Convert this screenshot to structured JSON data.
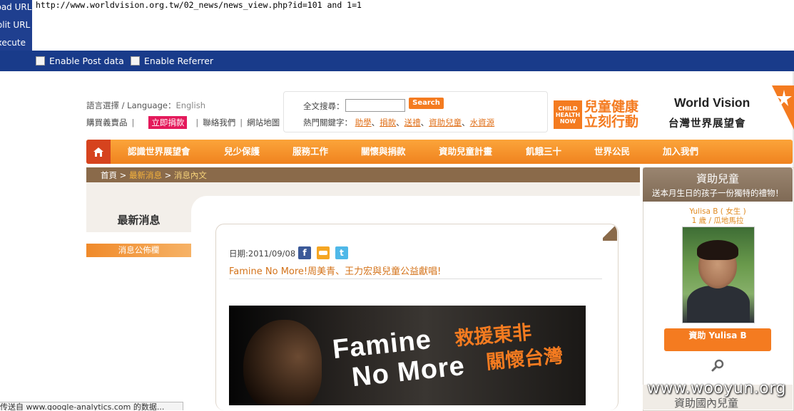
{
  "hackbar": {
    "left_items": [
      "Load URL",
      "Split URL",
      "Execute"
    ],
    "url": "http://www.worldvision.org.tw/02_news/news_view.php?id=101 and 1=1",
    "enable_post": "Enable Post data",
    "enable_referrer": "Enable Referrer"
  },
  "header": {
    "language_label": "語言選擇 / Language：",
    "language_value": "English",
    "links": {
      "shop": "購買義賣品",
      "donate": "立即捐款",
      "contact": "聯絡我們",
      "sitemap": "網站地圖"
    },
    "search": {
      "label": "全文搜尋：",
      "button": "Search >",
      "value": ""
    },
    "hot_label": "熱門關鍵字：",
    "hot_keywords": [
      "助學",
      "捐款",
      "送禮",
      "資助兒童",
      "水資源"
    ],
    "child_health": {
      "box": "CHILD HEALTH NOW",
      "line1": "兒童健康",
      "line2": "立刻行動"
    },
    "wv_logo": {
      "en": "World Vision",
      "zh": "台灣世界展望會"
    }
  },
  "nav": {
    "items": [
      "認識世界展望會",
      "兒少保護",
      "服務工作",
      "關懷與捐款",
      "資助兒童計畫",
      "飢餓三十",
      "世界公民",
      "加入我們"
    ]
  },
  "breadcrumb": {
    "home": "首頁",
    "sep": ">",
    "section": "最新消息",
    "current": "消息內文"
  },
  "sidebar": {
    "title": "最新消息",
    "item": "消息公佈欄"
  },
  "article": {
    "date": "日期:2011/09/08",
    "title": "Famine No More!周美青、王力宏與兒童公益獻唱!",
    "banner_en_1": "Famine",
    "banner_en_2": "No More",
    "banner_zh_1": "救援東非",
    "banner_zh_2": "關懷台灣"
  },
  "sponsor": {
    "title": "資助兒童",
    "subtitle": "送本月生日的孩子一份獨特的禮物！",
    "child_name": "Yulisa B ( 女生 )",
    "child_age": "1 歲 / 瓜地馬拉",
    "button": "資助 Yulisa B",
    "footer": "資助國內兒童"
  },
  "watermark": "www.wooyun.org",
  "status_bar": "传送自 www.google-analytics.com 的数据..."
}
